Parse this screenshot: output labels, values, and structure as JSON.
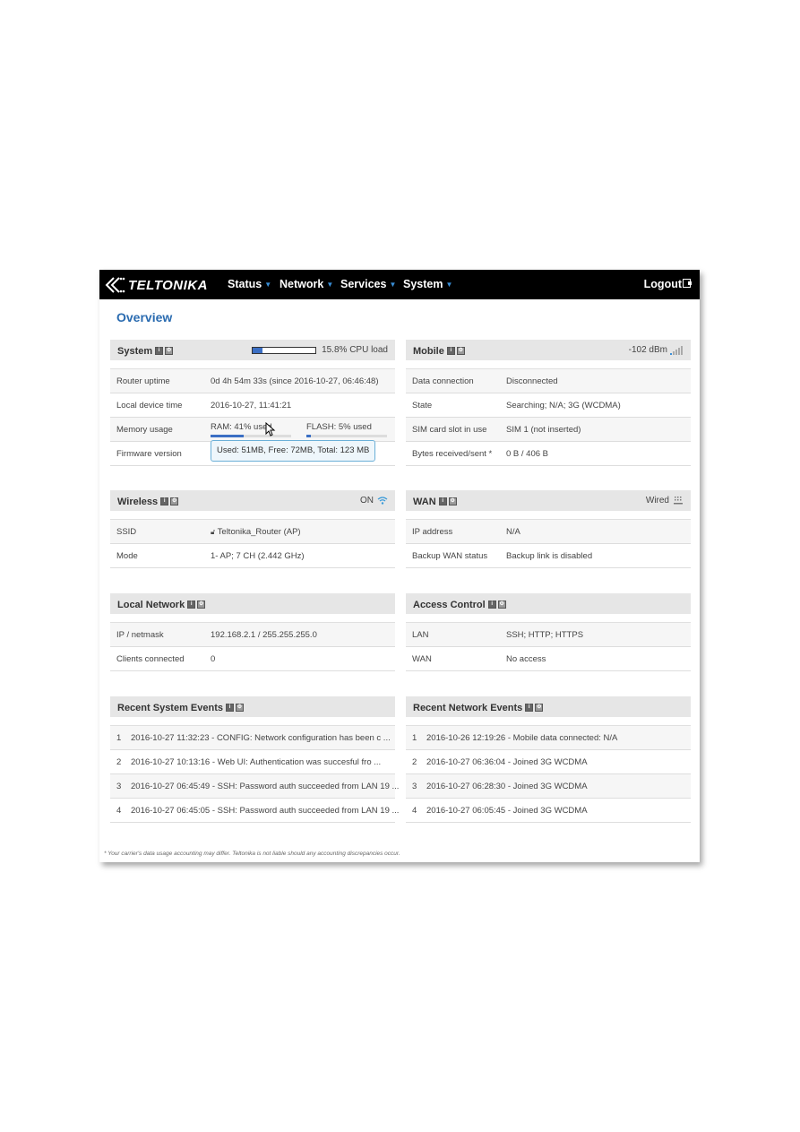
{
  "navbar": {
    "brand": "TELTONIKA",
    "items": [
      {
        "label": "Status"
      },
      {
        "label": "Network"
      },
      {
        "label": "Services"
      },
      {
        "label": "System"
      }
    ],
    "logout": "Logout"
  },
  "page_title": "Overview",
  "panels": {
    "system": {
      "title": "System",
      "cpu_load_label": "15.8% CPU load",
      "cpu_load_percent": 15.8,
      "rows": [
        {
          "key": "Router uptime",
          "value": "0d 4h 54m 33s (since 2016-10-27, 06:46:48)"
        },
        {
          "key": "Local device time",
          "value": "2016-10-27, 11:41:21"
        },
        {
          "key": "Memory usage",
          "value": ""
        },
        {
          "key": "Firmware version",
          "value": ""
        }
      ],
      "memory": {
        "ram_label": "RAM: 41% used",
        "ram_percent": 41,
        "flash_label": "FLASH: 5% used",
        "flash_percent": 5
      },
      "tooltip": "Used: 51MB, Free: 72MB, Total: 123 MB"
    },
    "mobile": {
      "title": "Mobile",
      "signal": "-102 dBm",
      "rows": [
        {
          "key": "Data connection",
          "value": "Disconnected"
        },
        {
          "key": "State",
          "value": "Searching; N/A; 3G (WCDMA)"
        },
        {
          "key": "SIM card slot in use",
          "value": "SIM 1 (not inserted)"
        },
        {
          "key": "Bytes received/sent *",
          "value": "0 B / 406 B"
        }
      ]
    },
    "wireless": {
      "title": "Wireless",
      "status": "ON",
      "rows": [
        {
          "key": "SSID",
          "value": "Teltonika_Router (AP)"
        },
        {
          "key": "Mode",
          "value": "1- AP; 7 CH (2.442 GHz)"
        }
      ]
    },
    "wan": {
      "title": "WAN",
      "status": "Wired",
      "rows": [
        {
          "key": "IP address",
          "value": "N/A"
        },
        {
          "key": "Backup WAN status",
          "value": "Backup link is disabled"
        }
      ]
    },
    "local_network": {
      "title": "Local Network",
      "rows": [
        {
          "key": "IP / netmask",
          "value": "192.168.2.1 / 255.255.255.0"
        },
        {
          "key": "Clients connected",
          "value": "0"
        }
      ]
    },
    "access_control": {
      "title": "Access Control",
      "rows": [
        {
          "key": "LAN",
          "value": "SSH; HTTP; HTTPS"
        },
        {
          "key": "WAN",
          "value": "No access"
        }
      ]
    },
    "system_events": {
      "title": "Recent System Events",
      "events": [
        {
          "num": "1",
          "text": "2016-10-27 11:32:23 - CONFIG: Network configuration has been c ..."
        },
        {
          "num": "2",
          "text": "2016-10-27 10:13:16 - Web UI: Authentication was succesful fro ..."
        },
        {
          "num": "3",
          "text": "2016-10-27 06:45:49 - SSH: Password auth succeeded from LAN 19 ..."
        },
        {
          "num": "4",
          "text": "2016-10-27 06:45:05 - SSH: Password auth succeeded from LAN 19 ..."
        }
      ]
    },
    "network_events": {
      "title": "Recent Network Events",
      "events": [
        {
          "num": "1",
          "text": "2016-10-26 12:19:26 - Mobile data connected: N/A"
        },
        {
          "num": "2",
          "text": "2016-10-27 06:36:04 - Joined 3G WCDMA"
        },
        {
          "num": "3",
          "text": "2016-10-27 06:28:30 - Joined 3G WCDMA"
        },
        {
          "num": "4",
          "text": "2016-10-27 06:05:45 - Joined 3G WCDMA"
        }
      ]
    }
  },
  "footnote": "* Your carrier's data usage accounting may differ. Teltonika is not liable should any accounting discrepancies occur.",
  "colors": {
    "accent": "#2a6bb0",
    "bar_fill": "#3b6fc4",
    "navbar": "#000000"
  }
}
